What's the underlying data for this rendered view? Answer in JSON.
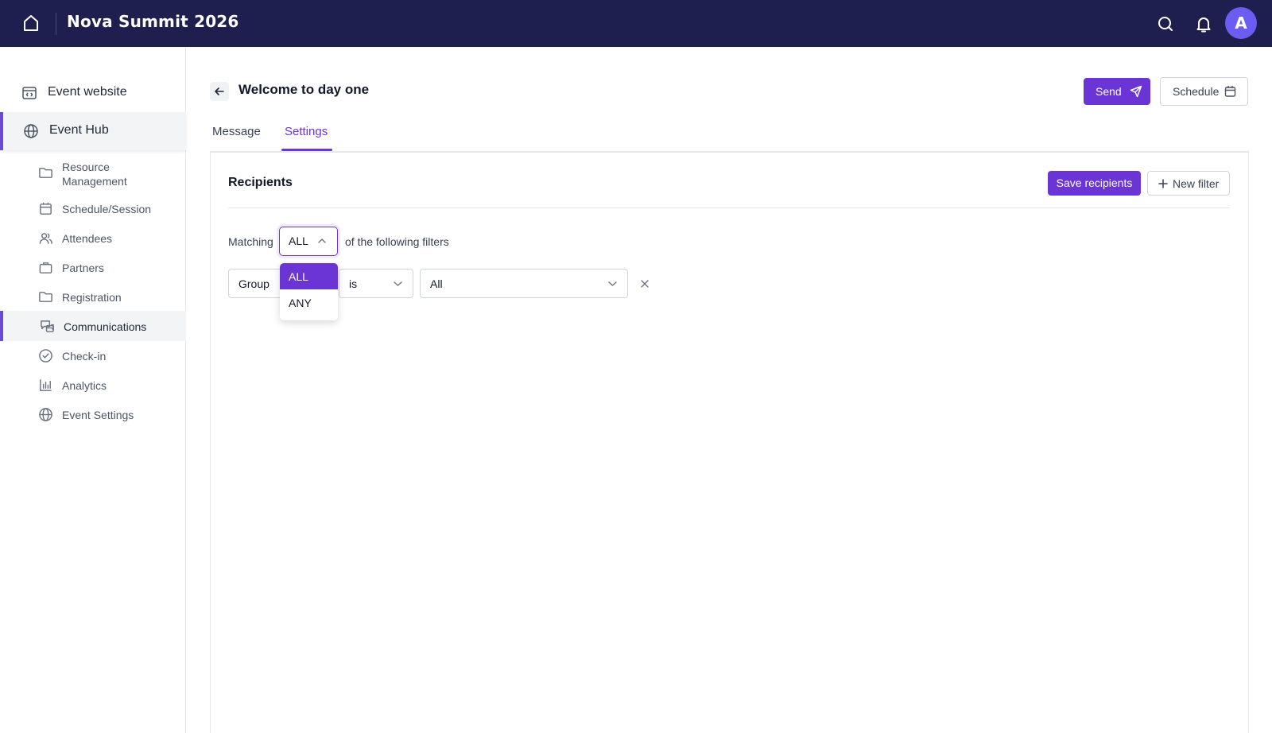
{
  "app": {
    "title": "Nova Summit 2026",
    "avatar_initial": "A"
  },
  "topbar_icons": [
    "home-icon",
    "search-icon",
    "bell-icon"
  ],
  "colors": {
    "topbar": "#1e1f4f",
    "accent": "#6a35d4",
    "avatar": "#6d5cf2"
  },
  "sidebar": {
    "top_items": [
      {
        "label": "Event website",
        "icon": "website-icon",
        "active": false
      },
      {
        "label": "Event Hub",
        "icon": "globe-icon",
        "active": true
      }
    ],
    "sub_items": [
      {
        "label": "Resource Management",
        "icon": "folder-icon",
        "active": false
      },
      {
        "label": "Schedule/Session",
        "icon": "calendar-icon",
        "active": false
      },
      {
        "label": "Attendees",
        "icon": "users-icon",
        "active": false
      },
      {
        "label": "Partners",
        "icon": "briefcase-icon",
        "active": false
      },
      {
        "label": "Registration",
        "icon": "folder-icon",
        "active": false
      },
      {
        "label": "Communications",
        "icon": "chat-icon",
        "active": true
      },
      {
        "label": "Check-in",
        "icon": "check-circle-icon",
        "active": false
      },
      {
        "label": "Analytics",
        "icon": "bar-chart-icon",
        "active": false
      },
      {
        "label": "Event Settings",
        "icon": "globe-icon",
        "active": false
      }
    ]
  },
  "page": {
    "title": "Welcome to day one",
    "send_label": "Send",
    "schedule_label": "Schedule",
    "tabs": [
      {
        "label": "Message",
        "active": false
      },
      {
        "label": "Settings",
        "active": true
      }
    ]
  },
  "recipients": {
    "title": "Recipients",
    "save_label": "Save recipients",
    "new_filter_label": "New filter",
    "matching_label": "Matching",
    "match_value": "ALL",
    "following_label": "of the following filters",
    "match_options": [
      "ALL",
      "ANY"
    ],
    "selected_option": "ALL",
    "filter": {
      "field": "Group",
      "operator": "is",
      "value": "All"
    }
  }
}
